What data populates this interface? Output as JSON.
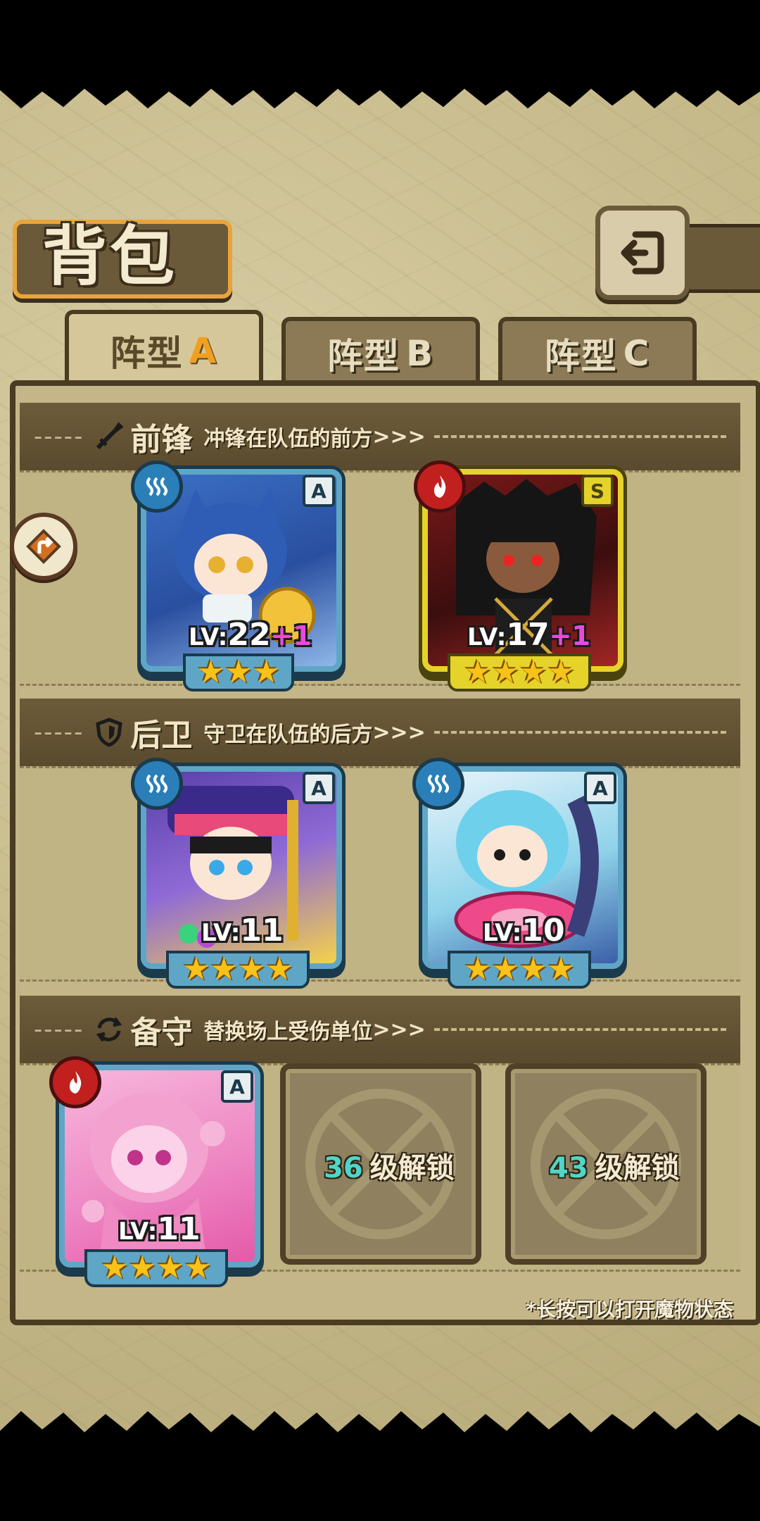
{
  "title": "背包",
  "tabs": [
    {
      "label": "阵型",
      "suffix": "A",
      "active": true
    },
    {
      "label": "阵型",
      "suffix": "B",
      "active": false
    },
    {
      "label": "阵型",
      "suffix": "C",
      "active": false
    }
  ],
  "sections": {
    "front": {
      "title": "前锋",
      "desc": "冲锋在队伍的前方",
      "arrow": ">>>",
      "icon": "sword-icon"
    },
    "back": {
      "title": "后卫",
      "desc": "守卫在队伍的后方",
      "arrow": ">>>",
      "icon": "shield-icon"
    },
    "reserve": {
      "title": "备守",
      "desc": "替换场上受伤单位",
      "arrow": ">>>",
      "icon": "swap-icon"
    }
  },
  "units": [
    {
      "id": "front-1",
      "element": "water",
      "rank": "A",
      "lv_label": "LV:",
      "level": "22",
      "bonus": "+1",
      "stars": 3
    },
    {
      "id": "front-2",
      "element": "fire",
      "rank": "S",
      "lv_label": "LV:",
      "level": "17",
      "bonus": "+1",
      "stars": 4
    },
    {
      "id": "back-1",
      "element": "water",
      "rank": "A",
      "lv_label": "LV:",
      "level": "11",
      "bonus": "",
      "stars": 4
    },
    {
      "id": "back-2",
      "element": "water",
      "rank": "A",
      "lv_label": "LV:",
      "level": "10",
      "bonus": "",
      "stars": 4
    },
    {
      "id": "reserve-1",
      "element": "fire",
      "rank": "A",
      "lv_label": "LV:",
      "level": "11",
      "bonus": "",
      "stars": 4
    }
  ],
  "locked_slots": [
    {
      "level": "36",
      "text": "级解锁"
    },
    {
      "level": "43",
      "text": "级解锁"
    }
  ],
  "hint": "*长按可以打开魔物状态",
  "colors": {
    "accent": "#f0a020",
    "water_frame": "#5fa6c6",
    "gold_frame": "#e6d32a",
    "fire": "#c21f1f",
    "water": "#2a7fb8"
  }
}
